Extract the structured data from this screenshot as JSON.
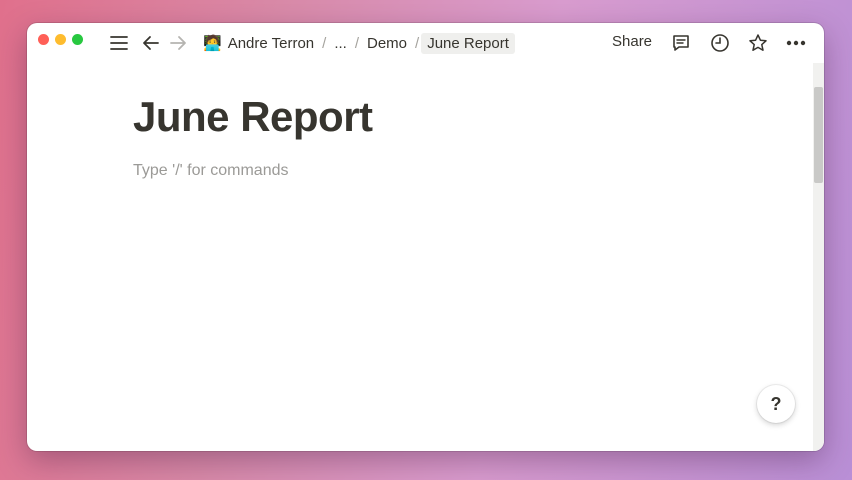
{
  "topbar": {
    "breadcrumb": [
      {
        "icon": "person-emoji-icon",
        "emoji": "🧑‍💻",
        "label": "Andre Terron"
      },
      {
        "label": "..."
      },
      {
        "label": "Demo"
      },
      {
        "label": "June Report"
      }
    ],
    "separator": "/",
    "share_label": "Share",
    "icons": [
      "menu-icon",
      "back-arrow-icon",
      "forward-arrow-icon",
      "comment-icon",
      "clock-icon",
      "star-icon",
      "more-icon"
    ]
  },
  "page": {
    "title": "June Report",
    "placeholder": "Type '/' for commands"
  },
  "help": {
    "label": "?"
  },
  "colors": {
    "text": "#37352f",
    "placeholder": "#9b9a97",
    "current_crumb_bg": "#efefed"
  }
}
